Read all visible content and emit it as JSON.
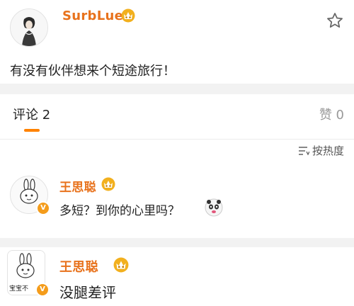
{
  "post": {
    "username": "SurbLue",
    "content": "有没有伙伴想来个短途旅行！",
    "icons": {
      "favorite": "star-outline-icon",
      "vip": "vip-crown-icon"
    }
  },
  "comments_header": {
    "tab_label": "评论 2",
    "like_label": "赞 0",
    "sort_label": "按热度",
    "accent_color": "#ff8200"
  },
  "comments": [
    {
      "username": "王思聪",
      "text": "多短？到你的心里吗？",
      "emoji": "panda-face-emoji",
      "verified": "v-badge"
    },
    {
      "username": "王思聪",
      "text": "没腿差评",
      "verified": "v-badge",
      "avatar_text": "宝宝不"
    }
  ],
  "colors": {
    "username": "#e8721c",
    "vip_gold": "#f2b01e"
  }
}
